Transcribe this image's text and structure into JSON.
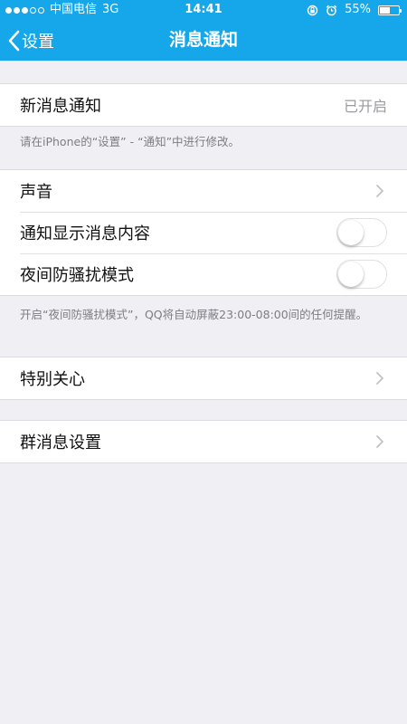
{
  "status_bar": {
    "carrier": "中国电信",
    "network": "3G",
    "time": "14:41",
    "battery": "55%",
    "battery_level": 55,
    "signal_strength": 3
  },
  "nav": {
    "back_label": "设置",
    "title": "消息通知"
  },
  "section1": {
    "new_message_label": "新消息通知",
    "new_message_value": "已开启",
    "note": "请在iPhone的“设置” - “通知”中进行修改。"
  },
  "section2": {
    "sound_label": "声音",
    "show_content_label": "通知显示消息内容",
    "show_content_on": false,
    "dnd_label": "夜间防骚扰模式",
    "dnd_on": false,
    "note": "开启“夜间防骚扰模式”，QQ将自动屏蔽23:00-08:00间的任何提醒。"
  },
  "section3": {
    "special_care_label": "特别关心"
  },
  "section4": {
    "group_settings_label": "群消息设置"
  },
  "colors": {
    "accent": "#15a7e9",
    "background": "#efeff4",
    "secondary_text": "#9a9aa0"
  }
}
